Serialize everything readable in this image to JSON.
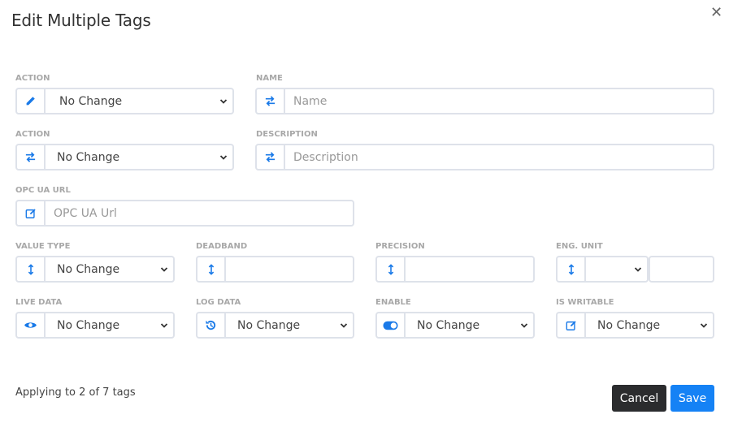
{
  "dialog": {
    "title": "Edit Multiple Tags",
    "close_icon": "close-icon"
  },
  "fields": {
    "action1": {
      "label": "ACTION",
      "value": "No Change",
      "icon": "pencil-icon"
    },
    "name": {
      "label": "NAME",
      "placeholder": "Name",
      "icon": "exchange-icon"
    },
    "action2": {
      "label": "ACTION",
      "value": "No Change",
      "icon": "exchange-icon"
    },
    "description": {
      "label": "DESCRIPTION",
      "placeholder": "Description",
      "icon": "exchange-icon"
    },
    "opc_ua_url": {
      "label": "OPC UA URL",
      "placeholder": "OPC UA Url",
      "icon": "edit-square-icon"
    },
    "value_type": {
      "label": "VALUE TYPE",
      "value": "No Change",
      "icon": "vertical-arrows-icon"
    },
    "deadband": {
      "label": "DEADBAND",
      "value": "",
      "icon": "vertical-arrows-icon"
    },
    "precision": {
      "label": "PRECISION",
      "value": "",
      "icon": "vertical-arrows-icon"
    },
    "eng_unit": {
      "label": "ENG. UNIT",
      "value": "",
      "text_value": "",
      "icon": "vertical-arrows-icon"
    },
    "live_data": {
      "label": "LIVE DATA",
      "value": "No Change",
      "icon": "eye-icon"
    },
    "log_data": {
      "label": "LOG DATA",
      "value": "No Change",
      "icon": "history-icon"
    },
    "enable": {
      "label": "ENABLE",
      "value": "No Change",
      "icon": "toggle-on-icon"
    },
    "is_writable": {
      "label": "IS WRITABLE",
      "value": "No Change",
      "icon": "edit-square-icon"
    }
  },
  "footer": {
    "status": "Applying to 2 of 7 tags",
    "cancel_label": "Cancel",
    "save_label": "Save"
  },
  "colors": {
    "accent": "#1a7ae8",
    "save_bg": "#1582f5",
    "cancel_bg": "#2b2c2e",
    "border": "#dee2ea",
    "label": "#a8a8a8"
  }
}
